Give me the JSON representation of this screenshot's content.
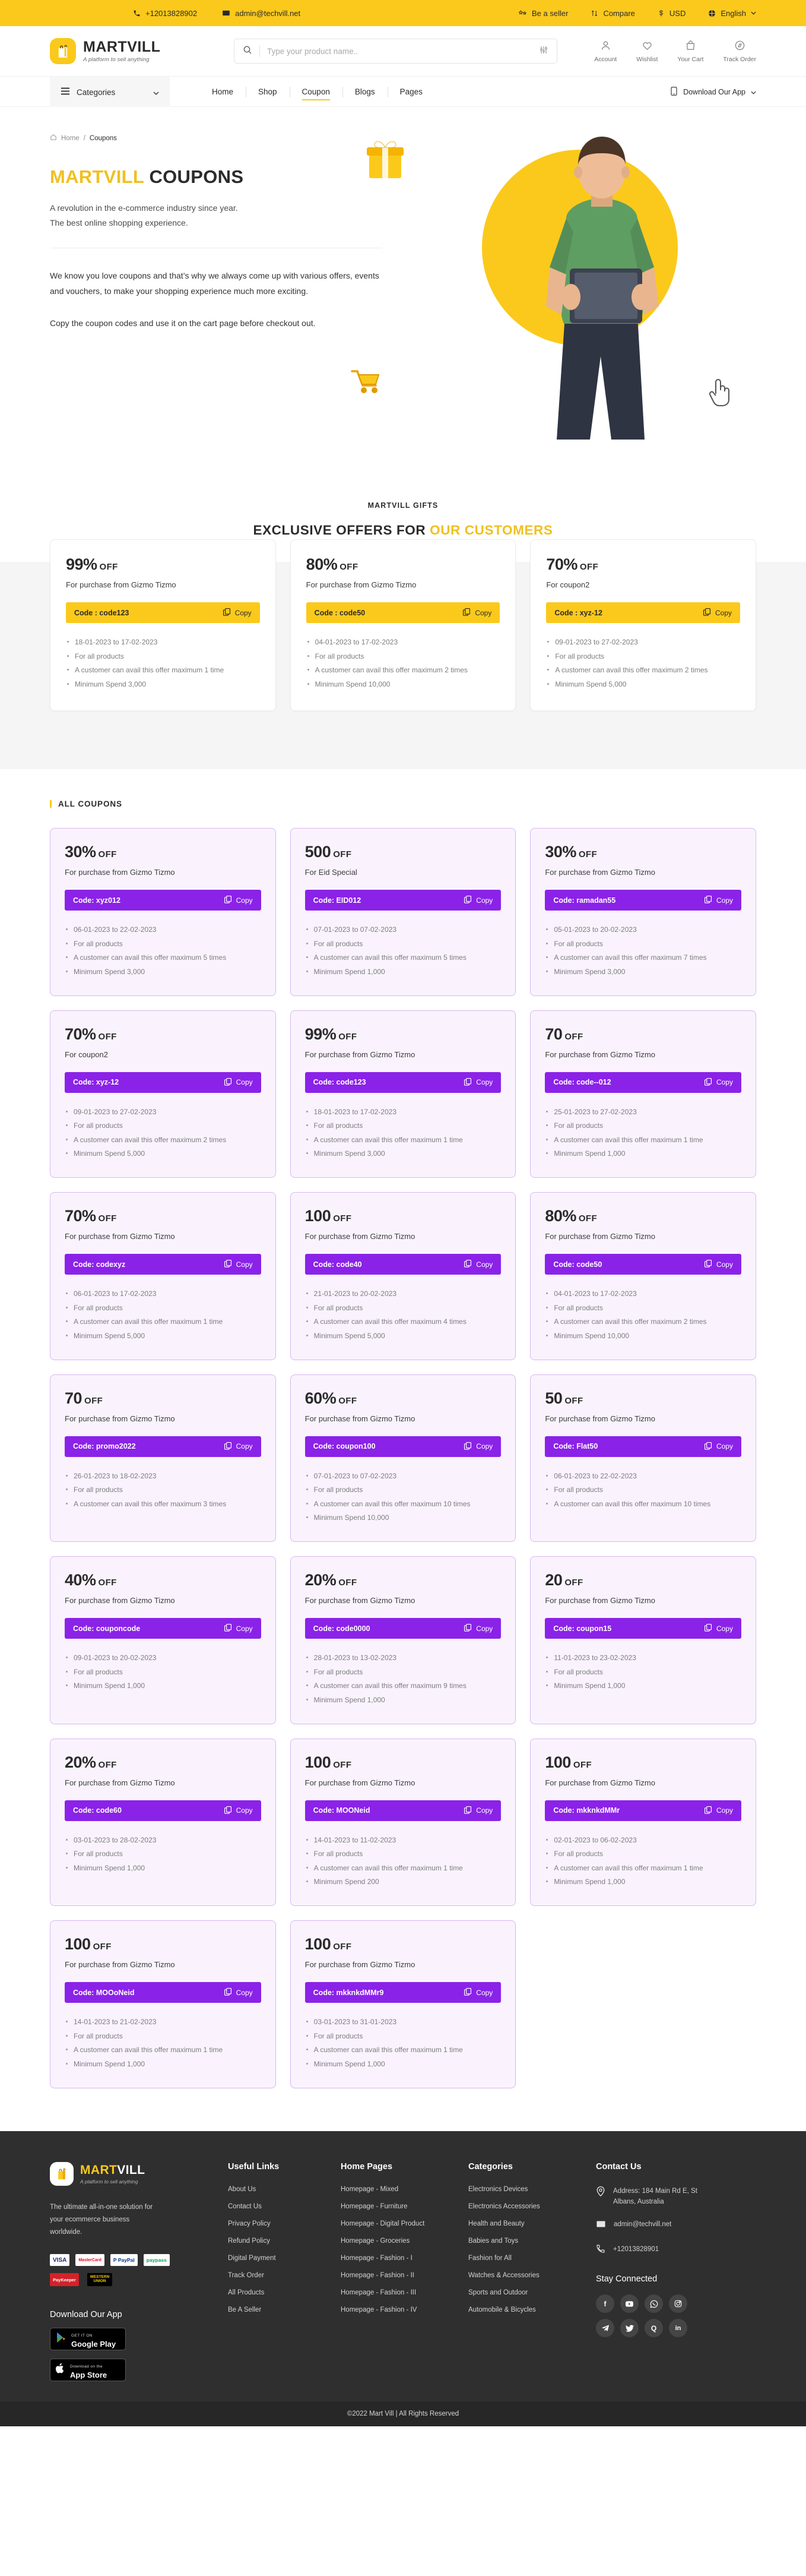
{
  "topbar": {
    "phone": "+12013828902",
    "email": "admin@techvill.net",
    "seller": "Be a seller",
    "compare": "Compare",
    "currency": "USD",
    "language": "English"
  },
  "header": {
    "brand": "MARTVILL",
    "tagline": "A platform to sell anything",
    "search_placeholder": "Type your product name..",
    "search_value": "",
    "actions": [
      {
        "label": "Account",
        "icon": "user-icon"
      },
      {
        "label": "Wishlist",
        "icon": "heart-icon"
      },
      {
        "label": "Your Cart",
        "icon": "bag-icon"
      },
      {
        "label": "Track Order",
        "icon": "compass-icon"
      }
    ]
  },
  "nav": {
    "categories_label": "Categories",
    "items": [
      {
        "label": "Home",
        "active": false
      },
      {
        "label": "Shop",
        "active": false
      },
      {
        "label": "Coupon",
        "active": true
      },
      {
        "label": "Blogs",
        "active": false
      },
      {
        "label": "Pages",
        "active": false
      }
    ],
    "download_label": "Download Our App"
  },
  "hero": {
    "breadcrumb_home": "Home",
    "breadcrumb_sep": "/",
    "breadcrumb_current": "Coupons",
    "title_yellow": "MARTVILL",
    "title_rest": " COUPONS",
    "subtitle_line1": "A revolution in the e-commerce industry since year.",
    "subtitle_line2": "The best online shopping experience.",
    "body_p1": "We know you love coupons and that’s why we always come up with various offers, events and vouchers, to make your shopping experience much more exciting.",
    "body_p2": "Copy the coupon codes and use it on the cart page before checkout out."
  },
  "exclusive": {
    "tag": "MARTVILL GIFTS",
    "heading_dark": "EXCLUSIVE OFFERS FOR ",
    "heading_yellow": "OUR CUSTOMERS",
    "cards": [
      {
        "off_value": "99%",
        "off_label": "OFF",
        "for": "For purchase from Gizmo Tizmo",
        "code_label": "Code : code123",
        "copy_label": "Copy",
        "details": [
          "18-01-2023 to 17-02-2023",
          "For all products",
          "A customer can avail this offer maximum 1 time",
          "Minimum Spend 3,000"
        ]
      },
      {
        "off_value": "80%",
        "off_label": "OFF",
        "for": "For purchase from Gizmo Tizmo",
        "code_label": "Code : code50",
        "copy_label": "Copy",
        "details": [
          "04-01-2023 to 17-02-2023",
          "For all products",
          "A customer can avail this offer maximum 2 times",
          "Minimum Spend 10,000"
        ]
      },
      {
        "off_value": "70%",
        "off_label": "OFF",
        "for": "For coupon2",
        "code_label": "Code : xyz-12",
        "copy_label": "Copy",
        "details": [
          "09-01-2023 to 27-02-2023",
          "For all products",
          "A customer can avail this offer maximum 2 times",
          "Minimum Spend 5,000"
        ]
      }
    ]
  },
  "all_coupons": {
    "section_title": "ALL COUPONS",
    "copy_label": "Copy",
    "cards": [
      {
        "off_value": "30%",
        "off_label": "OFF",
        "for": "For purchase from Gizmo Tizmo",
        "code_label": "Code: xyz012",
        "details": [
          "06-01-2023 to 22-02-2023",
          "For all products",
          "A customer can avail this offer maximum 5 times",
          "Minimum Spend 3,000"
        ]
      },
      {
        "off_value": "500",
        "off_label": "OFF",
        "for": "For Eid Special",
        "code_label": "Code: EID012",
        "details": [
          "07-01-2023 to 07-02-2023",
          "For all products",
          "A customer can avail this offer maximum 5 times",
          "Minimum Spend 1,000"
        ]
      },
      {
        "off_value": "30%",
        "off_label": "OFF",
        "for": "For purchase from Gizmo Tizmo",
        "code_label": "Code: ramadan55",
        "details": [
          "05-01-2023 to 20-02-2023",
          "For all products",
          "A customer can avail this offer maximum 7 times",
          "Minimum Spend 3,000"
        ]
      },
      {
        "off_value": "70%",
        "off_label": "OFF",
        "for": "For coupon2",
        "code_label": "Code: xyz-12",
        "details": [
          "09-01-2023 to 27-02-2023",
          "For all products",
          "A customer can avail this offer maximum 2 times",
          "Minimum Spend 5,000"
        ]
      },
      {
        "off_value": "99%",
        "off_label": "OFF",
        "for": "For purchase from Gizmo Tizmo",
        "code_label": "Code: code123",
        "details": [
          "18-01-2023 to 17-02-2023",
          "For all products",
          "A customer can avail this offer maximum 1 time",
          "Minimum Spend 3,000"
        ]
      },
      {
        "off_value": "70",
        "off_label": "OFF",
        "for": "For purchase from Gizmo Tizmo",
        "code_label": "Code: code--012",
        "details": [
          "25-01-2023 to 27-02-2023",
          "For all products",
          "A customer can avail this offer maximum 1 time",
          "Minimum Spend 1,000"
        ]
      },
      {
        "off_value": "70%",
        "off_label": "OFF",
        "for": "For purchase from Gizmo Tizmo",
        "code_label": "Code: codexyz",
        "details": [
          "06-01-2023 to 17-02-2023",
          "For all products",
          "A customer can avail this offer maximum 1 time",
          "Minimum Spend 5,000"
        ]
      },
      {
        "off_value": "100",
        "off_label": "OFF",
        "for": "For purchase from Gizmo Tizmo",
        "code_label": "Code: code40",
        "details": [
          "21-01-2023 to 20-02-2023",
          "For all products",
          "A customer can avail this offer maximum 4 times",
          "Minimum Spend 5,000"
        ]
      },
      {
        "off_value": "80%",
        "off_label": "OFF",
        "for": "For purchase from Gizmo Tizmo",
        "code_label": "Code: code50",
        "details": [
          "04-01-2023 to 17-02-2023",
          "For all products",
          "A customer can avail this offer maximum 2 times",
          "Minimum Spend 10,000"
        ]
      },
      {
        "off_value": "70",
        "off_label": "OFF",
        "for": "For purchase from Gizmo Tizmo",
        "code_label": "Code: promo2022",
        "details": [
          "26-01-2023 to 18-02-2023",
          "For all products",
          "A customer can avail this offer maximum 3 times"
        ]
      },
      {
        "off_value": "60%",
        "off_label": "OFF",
        "for": "For purchase from Gizmo Tizmo",
        "code_label": "Code: coupon100",
        "details": [
          "07-01-2023 to 07-02-2023",
          "For all products",
          "A customer can avail this offer maximum 10 times",
          "Minimum Spend 10,000"
        ]
      },
      {
        "off_value": "50",
        "off_label": "OFF",
        "for": "For purchase from Gizmo Tizmo",
        "code_label": "Code: Flat50",
        "details": [
          "06-01-2023 to 22-02-2023",
          "For all products",
          "A customer can avail this offer maximum 10 times"
        ]
      },
      {
        "off_value": "40%",
        "off_label": "OFF",
        "for": "For purchase from Gizmo Tizmo",
        "code_label": "Code: couponcode",
        "details": [
          "09-01-2023 to 20-02-2023",
          "For all products",
          "Minimum Spend 1,000"
        ]
      },
      {
        "off_value": "20%",
        "off_label": "OFF",
        "for": "For purchase from Gizmo Tizmo",
        "code_label": "Code: code0000",
        "details": [
          "28-01-2023 to 13-02-2023",
          "For all products",
          "A customer can avail this offer maximum 9 times",
          "Minimum Spend 1,000"
        ]
      },
      {
        "off_value": "20",
        "off_label": "OFF",
        "for": "For purchase from Gizmo Tizmo",
        "code_label": "Code: coupon15",
        "details": [
          "11-01-2023 to 23-02-2023",
          "For all products",
          "Minimum Spend 1,000"
        ]
      },
      {
        "off_value": "20%",
        "off_label": "OFF",
        "for": "For purchase from Gizmo Tizmo",
        "code_label": "Code: code60",
        "details": [
          "03-01-2023 to 28-02-2023",
          "For all products",
          "Minimum Spend 1,000"
        ]
      },
      {
        "off_value": "100",
        "off_label": "OFF",
        "for": "For purchase from Gizmo Tizmo",
        "code_label": "Code: MOONeid",
        "details": [
          "14-01-2023 to 11-02-2023",
          "For all products",
          "A customer can avail this offer maximum 1 time",
          "Minimum Spend 200"
        ]
      },
      {
        "off_value": "100",
        "off_label": "OFF",
        "for": "For purchase from Gizmo Tizmo",
        "code_label": "Code: mkknkdMMr",
        "details": [
          "02-01-2023 to 06-02-2023",
          "For all products",
          "A customer can avail this offer maximum 1 time",
          "Minimum Spend 1,000"
        ]
      },
      {
        "off_value": "100",
        "off_label": "OFF",
        "for": "For purchase from Gizmo Tizmo",
        "code_label": "Code: MOOoNeid",
        "details": [
          "14-01-2023 to 21-02-2023",
          "For all products",
          "A customer can avail this offer maximum 1 time",
          "Minimum Spend 1,000"
        ]
      },
      {
        "off_value": "100",
        "off_label": "OFF",
        "for": "For purchase from Gizmo Tizmo",
        "code_label": "Code: mkknkdMMr9",
        "details": [
          "03-01-2023 to 31-01-2023",
          "For all products",
          "A customer can avail this offer maximum 1 time",
          "Minimum Spend 1,000"
        ]
      }
    ]
  },
  "footer": {
    "brand": "MART",
    "brand_accent": "VILL",
    "tagline": "A platform to sell anything",
    "description": "The ultimate all-in-one solution for your ecommerce business worldwide.",
    "payments_row1": [
      "VISA",
      "MasterCard",
      "P PayPal",
      "paypass"
    ],
    "payments_row2": [
      "PayKeeper",
      "WESTERN UNION"
    ],
    "download_title": "Download Our App",
    "store_google_small": "GET IT ON",
    "store_google_big": "Google Play",
    "store_apple_small": "Download on the",
    "store_apple_big": "App Store",
    "useful_links_title": "Useful Links",
    "useful_links": [
      "About Us",
      "Contact Us",
      "Privacy Policy",
      "Refund Policy",
      "Digital Payment",
      "Track Order",
      "All Products",
      "Be A Seller"
    ],
    "home_pages_title": "Home Pages",
    "home_pages": [
      "Homepage - Mixed",
      "Homepage - Furniture",
      "Homepage - Digital Product",
      "Homepage - Groceries",
      "Homepage - Fashion - I",
      "Homepage - Fashion - II",
      "Homepage - Fashion - III",
      "Homepage - Fashion - IV"
    ],
    "categories_title": "Categories",
    "categories": [
      "Electronics Devices",
      "Electronics Accessories",
      "Health and Beauty",
      "Babies and Toys",
      "Fashion for All",
      "Watches & Accessories",
      "Sports and Outdoor",
      "Automobile & Bicycles"
    ],
    "contact_title": "Contact Us",
    "address": "Address: 184 Main Rd E, St Albans, Australia",
    "email": "admin@techvill.net",
    "phone": "+12013828901",
    "stay_connected": "Stay Connected",
    "socials": [
      "facebook-icon",
      "youtube-icon",
      "whatsapp-icon",
      "instagram-icon",
      "telegram-icon",
      "twitter-icon",
      "quora-icon",
      "linkedin-icon"
    ]
  },
  "copyright": "©2022 Mart Vill | All Rights Reserved",
  "colors": {
    "accent_yellow": "#fbc91b",
    "accent_purple": "#8b22e8",
    "footer_dark": "#2f2f2f"
  }
}
